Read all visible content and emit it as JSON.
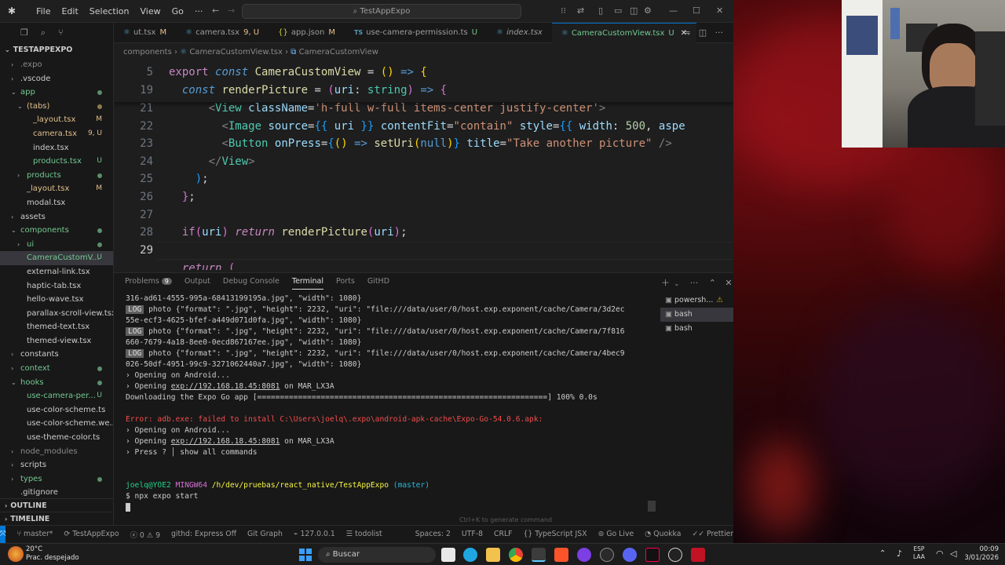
{
  "window": {
    "title": "TestAppExpo",
    "menu": [
      "File",
      "Edit",
      "Selection",
      "View",
      "Go",
      "···"
    ]
  },
  "explorer": {
    "title": "TESTAPPEXPO",
    "items": [
      {
        "label": ".expo",
        "depth": 1,
        "chev": "›",
        "color": "#8a8a8a",
        "status": ""
      },
      {
        "label": ".vscode",
        "depth": 1,
        "chev": "›",
        "color": "#cccccc",
        "status": ""
      },
      {
        "label": "app",
        "depth": 1,
        "chev": "⌄",
        "color": "#73c991",
        "status": "dot-green"
      },
      {
        "label": "(tabs)",
        "depth": 2,
        "chev": "⌄",
        "color": "#e2c08d",
        "status": "dot-yellow"
      },
      {
        "label": "_layout.tsx",
        "depth": 3,
        "chev": "",
        "color": "#e2c08d",
        "status": "M"
      },
      {
        "label": "camera.tsx",
        "depth": 3,
        "chev": "",
        "color": "#e2c08d",
        "status": "9, U"
      },
      {
        "label": "index.tsx",
        "depth": 3,
        "chev": "",
        "color": "#cccccc",
        "status": ""
      },
      {
        "label": "products.tsx",
        "depth": 3,
        "chev": "",
        "color": "#73c991",
        "status": "U"
      },
      {
        "label": "products",
        "depth": 2,
        "chev": "›",
        "color": "#73c991",
        "status": "dot-green"
      },
      {
        "label": "_layout.tsx",
        "depth": 2,
        "chev": "",
        "color": "#e2c08d",
        "status": "M"
      },
      {
        "label": "modal.tsx",
        "depth": 2,
        "chev": "",
        "color": "#cccccc",
        "status": ""
      },
      {
        "label": "assets",
        "depth": 1,
        "chev": "›",
        "color": "#cccccc",
        "status": ""
      },
      {
        "label": "components",
        "depth": 1,
        "chev": "⌄",
        "color": "#73c991",
        "status": "dot-green"
      },
      {
        "label": "ui",
        "depth": 2,
        "chev": "›",
        "color": "#73c991",
        "status": "dot-green"
      },
      {
        "label": "CameraCustomV...",
        "depth": 2,
        "chev": "",
        "color": "#73c991",
        "status": "U",
        "selected": true
      },
      {
        "label": "external-link.tsx",
        "depth": 2,
        "chev": "",
        "color": "#cccccc",
        "status": ""
      },
      {
        "label": "haptic-tab.tsx",
        "depth": 2,
        "chev": "",
        "color": "#cccccc",
        "status": ""
      },
      {
        "label": "hello-wave.tsx",
        "depth": 2,
        "chev": "",
        "color": "#cccccc",
        "status": ""
      },
      {
        "label": "parallax-scroll-view.tsx",
        "depth": 2,
        "chev": "",
        "color": "#cccccc",
        "status": ""
      },
      {
        "label": "themed-text.tsx",
        "depth": 2,
        "chev": "",
        "color": "#cccccc",
        "status": ""
      },
      {
        "label": "themed-view.tsx",
        "depth": 2,
        "chev": "",
        "color": "#cccccc",
        "status": ""
      },
      {
        "label": "constants",
        "depth": 1,
        "chev": "›",
        "color": "#cccccc",
        "status": ""
      },
      {
        "label": "context",
        "depth": 1,
        "chev": "›",
        "color": "#73c991",
        "status": "dot-green"
      },
      {
        "label": "hooks",
        "depth": 1,
        "chev": "⌄",
        "color": "#73c991",
        "status": "dot-green"
      },
      {
        "label": "use-camera-per...",
        "depth": 2,
        "chev": "",
        "color": "#73c991",
        "status": "U"
      },
      {
        "label": "use-color-scheme.ts",
        "depth": 2,
        "chev": "",
        "color": "#cccccc",
        "status": ""
      },
      {
        "label": "use-color-scheme.we...",
        "depth": 2,
        "chev": "",
        "color": "#cccccc",
        "status": ""
      },
      {
        "label": "use-theme-color.ts",
        "depth": 2,
        "chev": "",
        "color": "#cccccc",
        "status": ""
      },
      {
        "label": "node_modules",
        "depth": 1,
        "chev": "›",
        "color": "#8a8a8a",
        "status": ""
      },
      {
        "label": "scripts",
        "depth": 1,
        "chev": "›",
        "color": "#cccccc",
        "status": ""
      },
      {
        "label": "types",
        "depth": 1,
        "chev": "›",
        "color": "#73c991",
        "status": "dot-green"
      },
      {
        "label": ".gitignore",
        "depth": 1,
        "chev": "",
        "color": "#cccccc",
        "status": ""
      }
    ],
    "outline": "OUTLINE",
    "timeline": "TIMELINE"
  },
  "tabs": [
    {
      "label": "ut.tsx",
      "mod": "M",
      "icon": "⚛"
    },
    {
      "label": "camera.tsx",
      "mod": "9, U",
      "icon": "⚛"
    },
    {
      "label": "app.json",
      "mod": "M",
      "icon": "{}"
    },
    {
      "label": "use-camera-permission.ts",
      "mod": "U",
      "icon": "TS"
    },
    {
      "label": "index.tsx",
      "mod": "",
      "icon": "⚛"
    },
    {
      "label": "CameraCustomView.tsx",
      "mod": "U",
      "icon": "⚛",
      "active": true
    }
  ],
  "breadcrumb": {
    "a": "components",
    "b": "CameraCustomView.tsx",
    "c": "CameraCustomView"
  },
  "editor": {
    "lines": [
      "5",
      "19",
      "21",
      "22",
      "23",
      "24",
      "25",
      "26",
      "27",
      "28",
      "29",
      ""
    ]
  },
  "panel": {
    "tabs": [
      "Problems",
      "Output",
      "Debug Console",
      "Terminal",
      "Ports",
      "GitHD"
    ],
    "problems_count": "9",
    "terminals": [
      "powersh...",
      "bash",
      "bash"
    ],
    "term": {
      "l1": "316-ad61-4555-995a-68413199195a.jpg\", \"width\": 1080}",
      "l2a": "LOG",
      "l2b": " photo {\"format\": \".jpg\", \"height\": 2232, \"uri\": \"file:///data/user/0/host.exp.exponent/cache/Camera/3d2ec",
      "l3": "55e-ecf3-4625-bfef-a449d071d0fa.jpg\", \"width\": 1080}",
      "l4b": " photo {\"format\": \".jpg\", \"height\": 2232, \"uri\": \"file:///data/user/0/host.exp.exponent/cache/Camera/7f816",
      "l5": "660-7679-4a18-8ee0-0ecd867167ee.jpg\", \"width\": 1080}",
      "l6b": " photo {\"format\": \".jpg\", \"height\": 2232, \"uri\": \"file:///data/user/0/host.exp.exponent/cache/Camera/4bec9",
      "l7": "026-50df-4951-99c9-3271062440a7.jpg\", \"width\": 1080}",
      "open1": "› Opening on Android...",
      "open2a": "› Opening ",
      "url": "exp://192.168.18.45:8081",
      "on": " on ",
      "dev": "MAR_LX3A",
      "dl": "Downloading the Expo Go app [",
      "dlbar": "================================================================",
      "dlend": "] 100% 0.0s",
      "err": "Error: adb.exe: failed to install C:\\Users\\joelq\\.expo\\android-apk-cache\\Expo-Go-54.0.6.apk:",
      "press": "› Press ? │ show all commands",
      "prompt_user": "joelq@YOE2",
      "prompt_env": " MINGW64 ",
      "prompt_path": "/h/dev/pruebas/react_native/TestAppExpo",
      "prompt_branch": " (master)",
      "cmd": "$ npx expo start",
      "hint": "Ctrl+K to generate command"
    }
  },
  "status": {
    "branch": "master*",
    "project": "TestAppExpo",
    "errors": "0",
    "warnings": "9",
    "githd": "githd: Express Off",
    "gitgraph": "Git Graph",
    "host": "127.0.0.1",
    "todolist": "todolist",
    "spaces": "Spaces: 2",
    "enc": "UTF-8",
    "eol": "CRLF",
    "lang": "TypeScript JSX",
    "golive": "Go Live",
    "quokka": "Quokka",
    "prettier": "Prettier"
  },
  "taskbar": {
    "temp": "20°C",
    "weather": "Prac. despejado",
    "search": "Buscar",
    "lang1": "ESP",
    "lang2": "LAA",
    "time": "00:09",
    "date": "3/01/2026"
  },
  "colors": {
    "accent": "#0078d4",
    "git_added": "#73c991",
    "git_modified": "#e2c08d"
  }
}
